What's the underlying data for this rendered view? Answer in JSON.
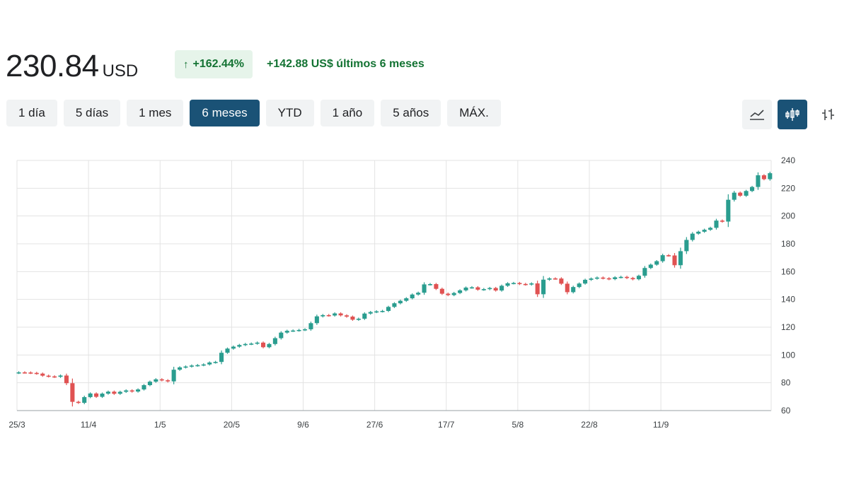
{
  "header": {
    "price": "230.84",
    "currency": "USD",
    "change_pct_arrow": "↑",
    "change_pct": "+162.44%",
    "change_abs": "+142.88",
    "change_abs_unit": "US$ últimos 6 meses",
    "color_up": "#137333"
  },
  "ranges": [
    "1 día",
    "5 días",
    "1 mes",
    "6 meses",
    "YTD",
    "1 año",
    "5 años",
    "MÁX."
  ],
  "active_range": "6 meses",
  "tools": [
    {
      "icon": "line-chart-icon",
      "active": false
    },
    {
      "icon": "candlestick-chart-icon",
      "active": true
    },
    {
      "icon": "ohlc-bars-icon",
      "active": false
    }
  ],
  "colors": {
    "up": "#2a9d8f",
    "down": "#e05252",
    "grid": "#e3e3e3",
    "accent": "#1a5276"
  },
  "chart_data": {
    "type": "candlestick",
    "ylim": [
      60,
      240
    ],
    "yticks": [
      60,
      80,
      100,
      120,
      140,
      160,
      180,
      200,
      220,
      240
    ],
    "xtick_labels": [
      "25/3",
      "11/4",
      "1/5",
      "20/5",
      "9/6",
      "27/6",
      "17/7",
      "5/8",
      "22/8",
      "11/9"
    ],
    "xtick_index": [
      0,
      12,
      24,
      36,
      48,
      60,
      72,
      84,
      96,
      108
    ],
    "close": [
      87.5,
      87.4,
      87.1,
      86.6,
      85.1,
      84.6,
      84.3,
      85.2,
      79.7,
      66.3,
      65.6,
      69.7,
      72.3,
      69.9,
      72.2,
      73.6,
      72.1,
      73.5,
      74.5,
      73.7,
      75.2,
      78.3,
      80.8,
      82.5,
      81.8,
      81.0,
      89.4,
      91.1,
      91.7,
      92.4,
      92.7,
      93.2,
      94.6,
      95.0,
      101.6,
      104.6,
      106.0,
      107.2,
      107.9,
      108.2,
      108.9,
      105.6,
      107.9,
      112.1,
      116.1,
      117.4,
      117.6,
      118.0,
      118.5,
      122.9,
      127.8,
      128.7,
      128.4,
      129.9,
      128.5,
      127.6,
      125.4,
      126.1,
      129.8,
      130.9,
      131.4,
      131.7,
      134.6,
      137.2,
      139.0,
      140.8,
      143.5,
      144.8,
      150.8,
      151.0,
      147.6,
      144.1,
      143.1,
      144.6,
      146.5,
      148.5,
      148.7,
      147.0,
      147.4,
      148.2,
      146.4,
      149.8,
      151.6,
      151.8,
      151.1,
      150.7,
      151.5,
      143.7,
      154.2,
      155.1,
      155.0,
      151.3,
      145.2,
      148.9,
      151.4,
      154.1,
      155.0,
      155.7,
      155.2,
      154.6,
      155.9,
      156.2,
      155.4,
      154.5,
      157.0,
      162.6,
      165.0,
      167.5,
      171.8,
      171.6,
      164.6,
      174.7,
      182.8,
      187.3,
      188.7,
      190.1,
      191.5,
      196.7,
      196.0,
      211.7,
      216.8,
      214.6,
      218.0,
      220.9,
      229.3,
      226.5,
      230.8
    ]
  }
}
